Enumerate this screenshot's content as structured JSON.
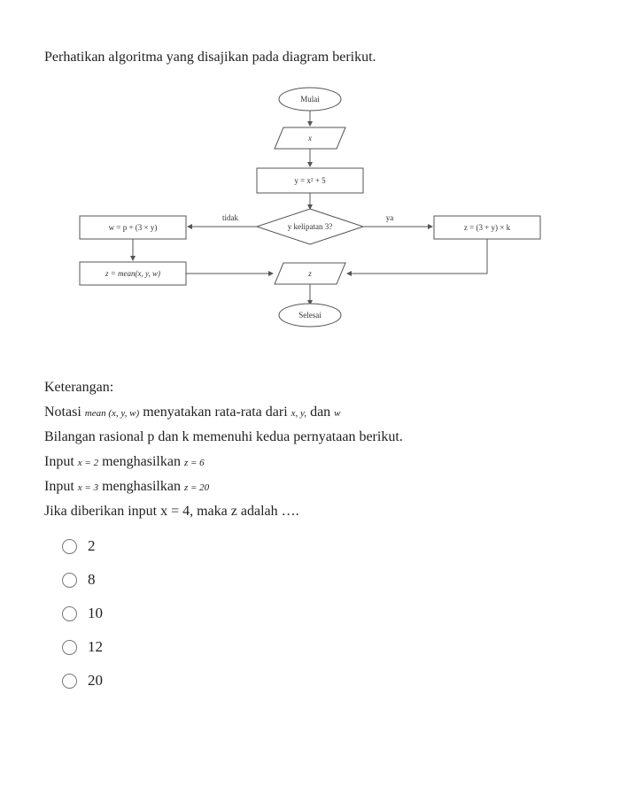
{
  "question": "Perhatikan algoritma yang disajikan pada diagram berikut.",
  "flow": {
    "start": "Mulai",
    "input": "x",
    "process1": "y = x² + 5",
    "decision": "y kelipatan 3?",
    "yes_label": "ya",
    "no_label": "tidak",
    "yes_branch": "z = (3 + y) × k",
    "no_branch": "w = p + (3 × y)",
    "mean": "z = mean(x, y, w)",
    "output": "z",
    "end": "Selesai"
  },
  "notes": {
    "heading": "Keterangan:",
    "line1_a": "Notasi ",
    "line1_b": "mean (x, y, w)",
    "line1_c": " menyatakan rata-rata dari ",
    "line1_d": "x, y,",
    "line1_e": " dan ",
    "line1_f": "w",
    "line2": "Bilangan rasional p dan k memenuhi kedua pernyataan berikut.",
    "line3_a": "Input ",
    "line3_b": "x = 2",
    "line3_c": " menghasilkan ",
    "line3_d": "z = 6",
    "line4_a": "Input ",
    "line4_b": "x = 3",
    "line4_c": " menghasilkan ",
    "line4_d": "z = 20",
    "line5": "Jika diberikan input x = 4, maka z adalah …."
  },
  "options": [
    "2",
    "8",
    "10",
    "12",
    "20"
  ],
  "chart_data": {
    "type": "flowchart",
    "nodes": [
      {
        "id": "start",
        "shape": "terminator",
        "label": "Mulai"
      },
      {
        "id": "in",
        "shape": "parallelogram",
        "label": "x"
      },
      {
        "id": "p1",
        "shape": "rectangle",
        "label": "y = x² + 5"
      },
      {
        "id": "dec",
        "shape": "diamond",
        "label": "y kelipatan 3?"
      },
      {
        "id": "yes",
        "shape": "rectangle",
        "label": "z = (3 + y) × k"
      },
      {
        "id": "no",
        "shape": "rectangle",
        "label": "w = p + (3 × y)"
      },
      {
        "id": "mean",
        "shape": "rectangle",
        "label": "z = mean(x, y, w)"
      },
      {
        "id": "out",
        "shape": "parallelogram",
        "label": "z"
      },
      {
        "id": "end",
        "shape": "terminator",
        "label": "Selesai"
      }
    ],
    "edges": [
      {
        "from": "start",
        "to": "in"
      },
      {
        "from": "in",
        "to": "p1"
      },
      {
        "from": "p1",
        "to": "dec"
      },
      {
        "from": "dec",
        "to": "yes",
        "label": "ya"
      },
      {
        "from": "dec",
        "to": "no",
        "label": "tidak"
      },
      {
        "from": "no",
        "to": "mean"
      },
      {
        "from": "mean",
        "to": "out"
      },
      {
        "from": "yes",
        "to": "out"
      },
      {
        "from": "out",
        "to": "end"
      }
    ]
  }
}
